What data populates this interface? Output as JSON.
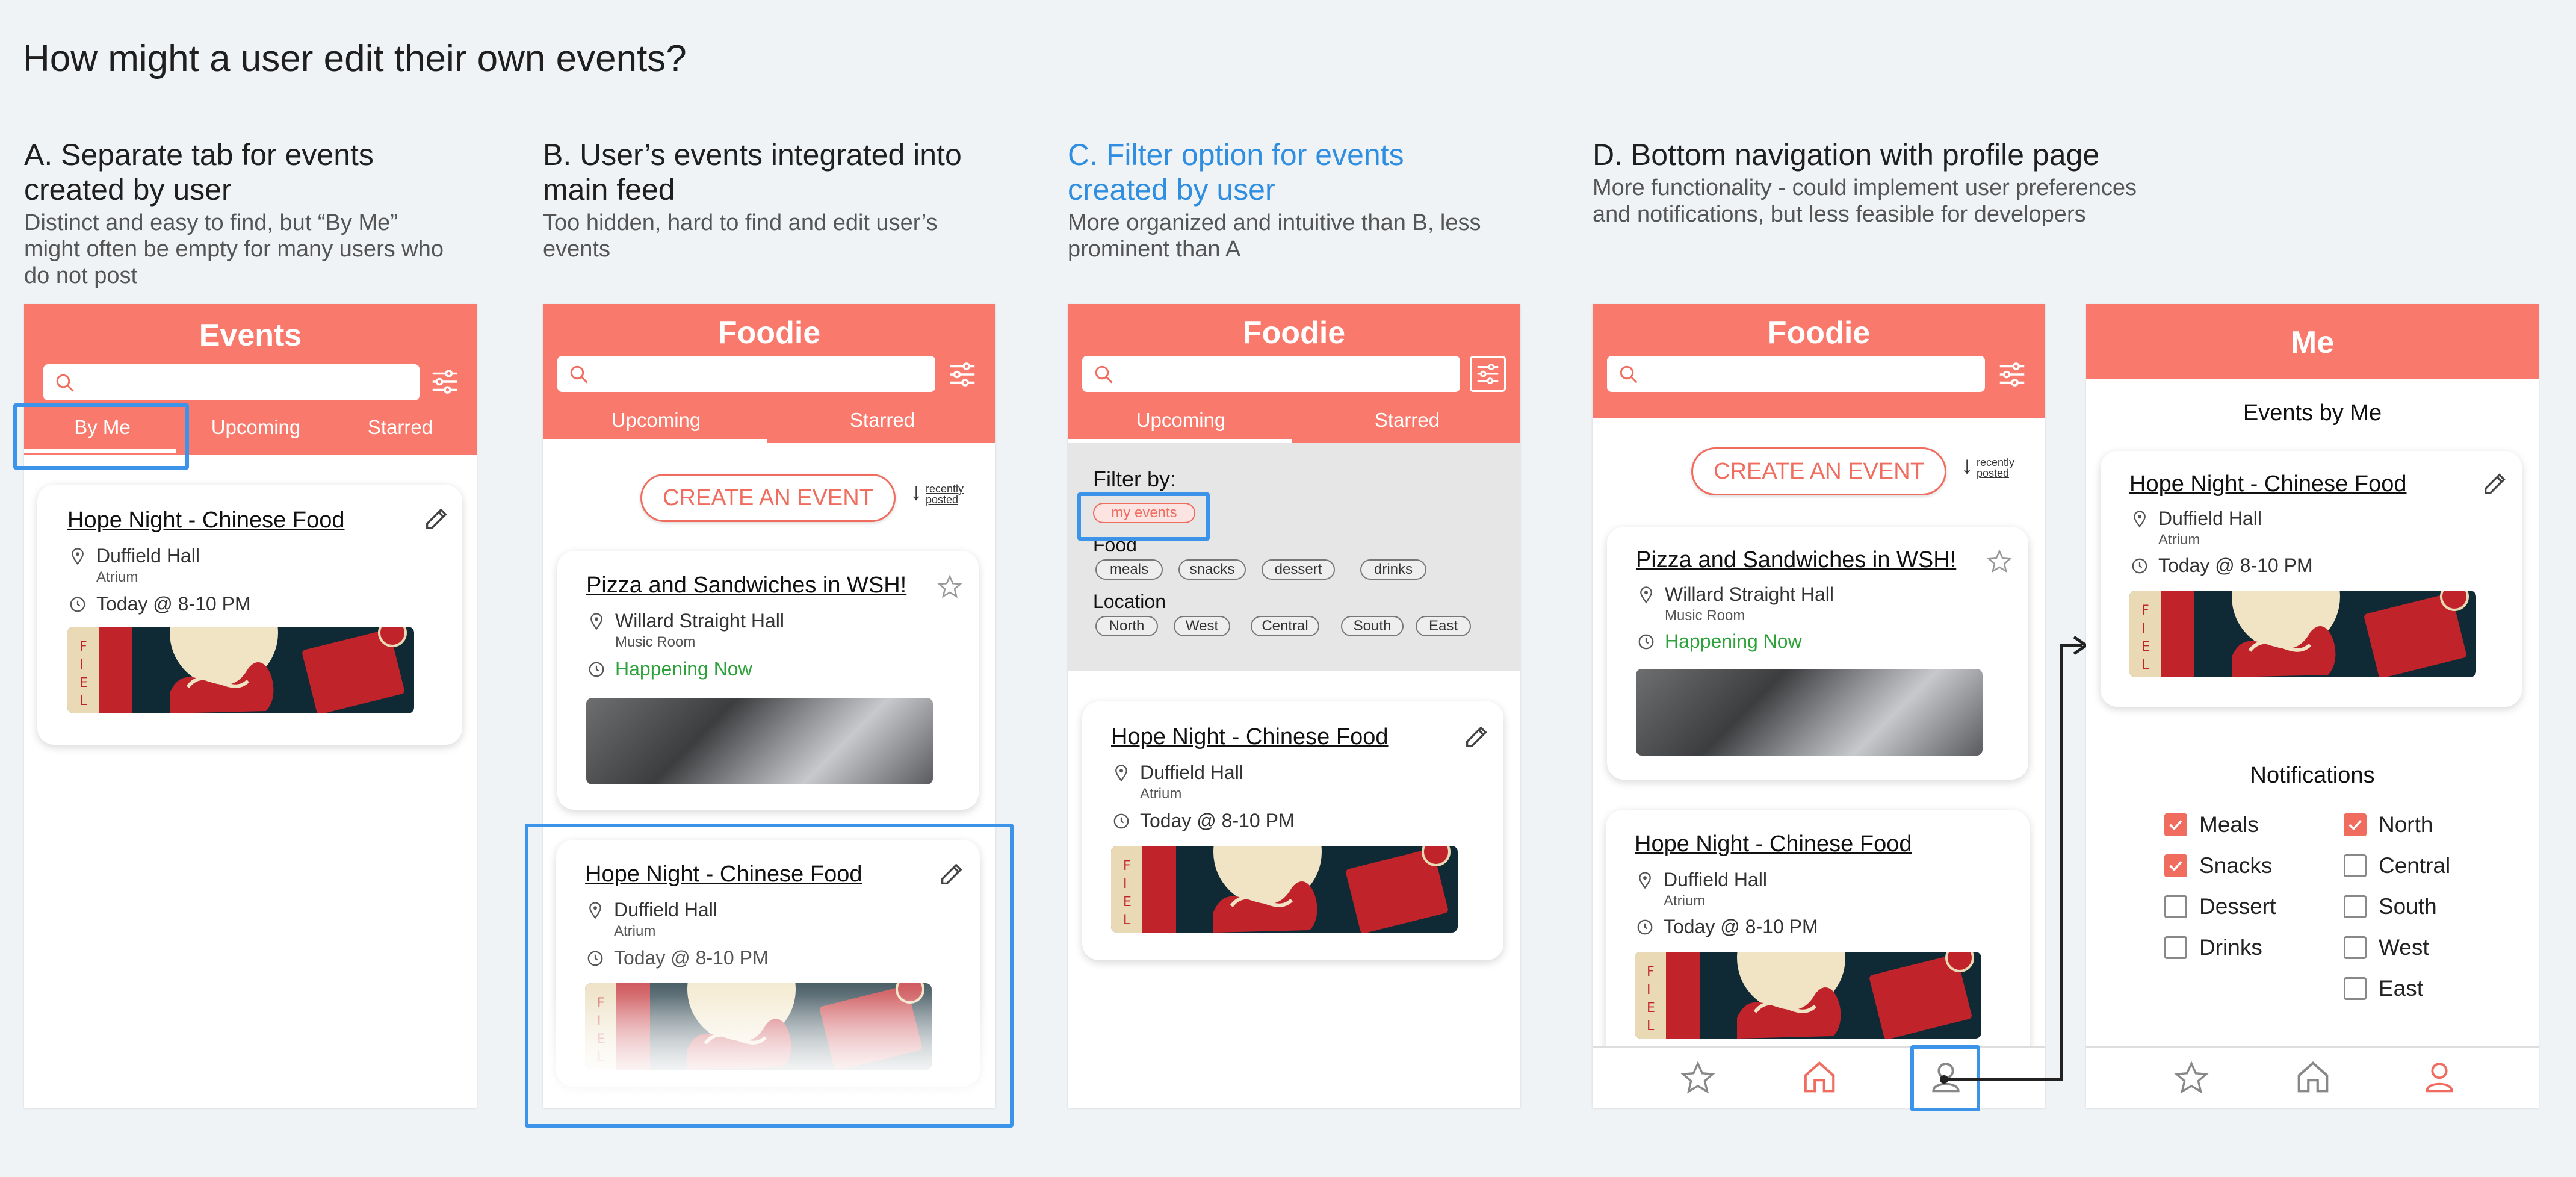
{
  "title": "How might a user edit their own events?",
  "options": [
    {
      "title": "A. Separate tab for events created by user",
      "desc": "Distinct and easy to find, but “By Me” might often be empty for many users who do not post"
    },
    {
      "title": "B. User’s events integrated into main feed",
      "desc": "Too hidden, hard to find and edit user’s events"
    },
    {
      "title": "C. Filter option for events created by user",
      "desc": "More organized and intuitive than B, less prominent than A"
    },
    {
      "title": "D. Bottom navigation with profile page",
      "desc": "More functionality - could implement user preferences and notifications, but less feasible for developers"
    }
  ],
  "colors": {
    "accent": "#f97a6d",
    "highlight": "#3b94ea",
    "happening": "#2ea23a",
    "selected_title": "#2f8ee0"
  },
  "app": {
    "events_title": "Events",
    "foodie_title": "Foodie",
    "me_title": "Me",
    "tabs_a": [
      "By Me",
      "Upcoming",
      "Starred"
    ],
    "tabs_b": [
      "Upcoming",
      "Starred"
    ],
    "create_event": "CREATE AN EVENT",
    "recently_posted_1": "recently",
    "recently_posted_2": "posted",
    "filter_by": "Filter by:",
    "my_events": "my events",
    "food_label": "Food",
    "food_chips": [
      "meals",
      "snacks",
      "dessert",
      "drinks"
    ],
    "location_label": "Location",
    "location_chips": [
      "North",
      "West",
      "Central",
      "South",
      "East"
    ],
    "events_by_me": "Events by Me",
    "notifications": "Notifications",
    "notif_food": [
      {
        "label": "Meals",
        "checked": true
      },
      {
        "label": "Snacks",
        "checked": true
      },
      {
        "label": "Dessert",
        "checked": false
      },
      {
        "label": "Drinks",
        "checked": false
      }
    ],
    "notif_loc": [
      {
        "label": "North",
        "checked": true
      },
      {
        "label": "Central",
        "checked": false
      },
      {
        "label": "South",
        "checked": false
      },
      {
        "label": "West",
        "checked": false
      },
      {
        "label": "East",
        "checked": false
      }
    ]
  },
  "events": {
    "hope": {
      "title": "Hope Night - Chinese Food",
      "place": "Duffield Hall",
      "room": "Atrium",
      "time": "Today @ 8-10 PM"
    },
    "pizza": {
      "title": "Pizza and Sandwiches in WSH!",
      "place": "Willard Straight Hall",
      "room": "Music Room",
      "time": "Happening Now"
    }
  },
  "icons": [
    "search-icon",
    "filter-icon",
    "pencil-icon",
    "star-icon",
    "location-pin-icon",
    "clock-icon",
    "home-icon",
    "profile-icon",
    "arrow-down-icon"
  ]
}
